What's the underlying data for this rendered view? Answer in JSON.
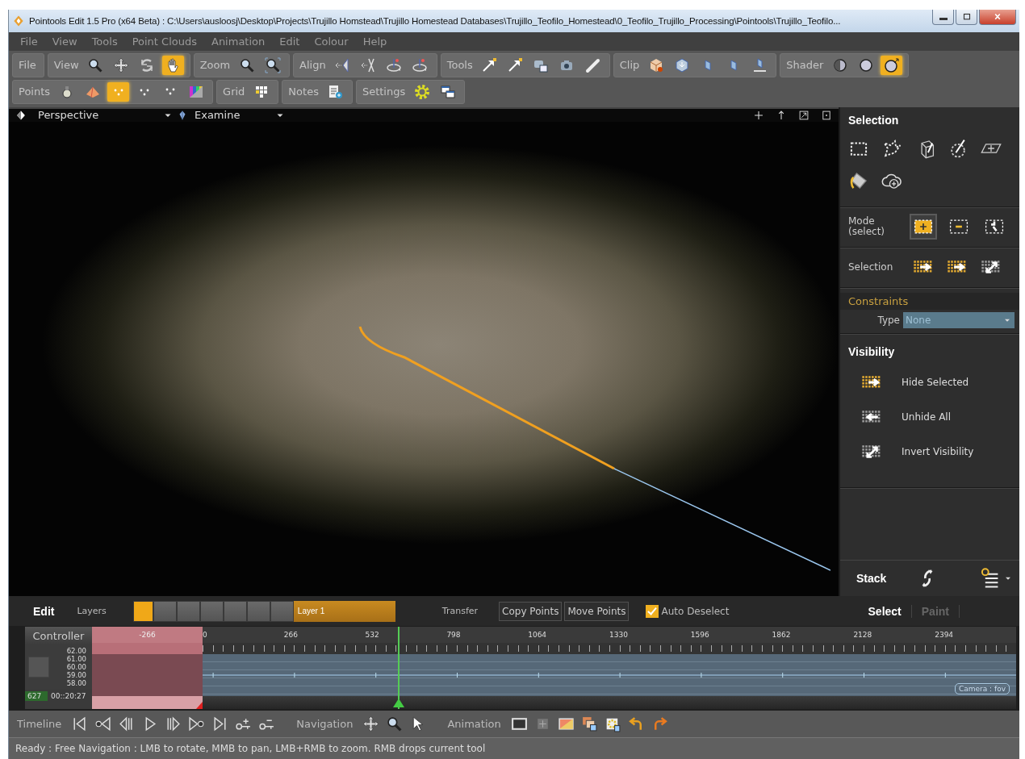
{
  "window": {
    "title": "Pointools Edit 1.5 Pro (x64 Beta)  :  C:\\Users\\ausloosj\\Desktop\\Projects\\Trujillo Homstead\\Trujillo Homestead Databases\\Trujillo_Teofilo_Homestead\\0_Teofilo_Trujillo_Processing\\Pointools\\Trujillo_Teofilo..."
  },
  "menu": [
    "File",
    "View",
    "Tools",
    "Point Clouds",
    "Animation",
    "Edit",
    "Colour",
    "Help"
  ],
  "toolbars": [
    {
      "groups": [
        {
          "label": "File"
        },
        {
          "label": "View",
          "tools": [
            {
              "kind": "magnifier",
              "selected": false
            },
            {
              "kind": "pan",
              "selected": false
            },
            {
              "kind": "orbit",
              "selected": false
            },
            {
              "kind": "hand",
              "selected": true
            }
          ]
        },
        {
          "label": "Zoom",
          "tools": [
            {
              "kind": "zoomframe",
              "selected": false
            },
            {
              "kind": "zoomcorners",
              "selected": false
            }
          ]
        },
        {
          "label": "Align",
          "tools": [
            {
              "kind": "aligntri",
              "selected": false
            },
            {
              "kind": "alignline",
              "selected": false
            },
            {
              "kind": "rotate",
              "selected": false
            },
            {
              "kind": "rotate",
              "selected": false
            }
          ]
        },
        {
          "label": "Tools",
          "tools": [
            {
              "kind": "arrowtool",
              "selected": false
            },
            {
              "kind": "arrowtool",
              "selected": false
            },
            {
              "kind": "camstack",
              "selected": false
            },
            {
              "kind": "camera",
              "selected": false
            },
            {
              "kind": "pencil",
              "selected": false
            }
          ]
        },
        {
          "label": "Clip",
          "tools": [
            {
              "kind": "cube",
              "selected": false
            },
            {
              "kind": "cubeout",
              "selected": false
            },
            {
              "kind": "plane",
              "selected": false
            },
            {
              "kind": "plane",
              "selected": false
            },
            {
              "kind": "planebase",
              "selected": false
            }
          ]
        },
        {
          "label": "Shader",
          "tools": [
            {
              "kind": "sphere",
              "selected": false
            },
            {
              "kind": "spherefull",
              "selected": false
            },
            {
              "kind": "spherearrow",
              "selected": true
            }
          ]
        }
      ]
    },
    {
      "groups": [
        {
          "label": "Points",
          "tools": [
            {
              "kind": "bulb",
              "selected": false
            },
            {
              "kind": "pyramid",
              "selected": false
            },
            {
              "kind": "dots",
              "selected": true
            },
            {
              "kind": "dots",
              "selected": false
            },
            {
              "kind": "dotsb",
              "selected": false
            },
            {
              "kind": "gradient",
              "selected": false
            }
          ]
        },
        {
          "label": "Grid",
          "tools": [
            {
              "kind": "grid",
              "selected": false
            }
          ]
        },
        {
          "label": "Notes",
          "tools": [
            {
              "kind": "note",
              "selected": false
            }
          ]
        },
        {
          "label": "Settings",
          "tools": [
            {
              "kind": "gear",
              "selected": false
            },
            {
              "kind": "windows",
              "selected": false
            }
          ]
        }
      ]
    }
  ],
  "viewport": {
    "projection": "Perspective",
    "mode": "Examine"
  },
  "side_panel": {
    "selection_title": "Selection",
    "selection_tools": [
      {
        "kind": "rectsel"
      },
      {
        "kind": "lasso"
      },
      {
        "kind": "box3d"
      },
      {
        "kind": "sphere3d"
      },
      {
        "kind": "planesel"
      },
      {
        "kind": "bucket"
      },
      {
        "kind": "cloudplus"
      }
    ],
    "mode_label": "Mode (select)",
    "modes": [
      {
        "kind": "add",
        "selected": true
      },
      {
        "kind": "subtract",
        "selected": false
      },
      {
        "kind": "undo",
        "selected": false
      }
    ],
    "selection_label": "Selection",
    "selection_ops": [
      {
        "kind": "gridright"
      },
      {
        "kind": "gridright"
      },
      {
        "kind": "griddiag"
      }
    ],
    "constraints_title": "Constraints",
    "type_label": "Type",
    "type_value": "None",
    "visibility_title": "Visibility",
    "visibility_actions": [
      {
        "kind": "gridright",
        "label": "Hide Selected"
      },
      {
        "kind": "gridleft",
        "label": "Unhide All"
      },
      {
        "kind": "griddiag",
        "label": "Invert Visibility"
      }
    ],
    "stack_title": "Stack"
  },
  "edit_bar": {
    "title": "Edit",
    "layers_label": "Layers",
    "layer_slots": [
      {
        "selected": true
      },
      {
        "selected": false
      },
      {
        "selected": false
      },
      {
        "selected": false
      },
      {
        "selected": false
      },
      {
        "selected": false
      },
      {
        "selected": false
      }
    ],
    "layer_name": "Layer 1",
    "transfer_label": "Transfer",
    "buttons": [
      "Copy Points",
      "Move Points"
    ],
    "auto_deselect": {
      "label": "Auto Deselect",
      "checked": true
    },
    "tabs": [
      {
        "label": "Select",
        "selected": true
      },
      {
        "label": "Paint",
        "selected": false
      }
    ]
  },
  "timeline": {
    "controller_label": "Controller",
    "ruler": [
      "-266",
      "0",
      "266",
      "532",
      "798",
      "1064",
      "1330",
      "1596",
      "1862",
      "2128",
      "2394"
    ],
    "values": [
      "62.00",
      "61.00",
      "60.00",
      "59.00",
      "58.00"
    ],
    "frame": "627",
    "time": "00::20:27",
    "track_label": "Camera : fov",
    "playhead": {
      "level": 0.332
    }
  },
  "transport": [
    {
      "label": "Timeline",
      "tools": [
        {
          "kind": "skipstart"
        },
        {
          "kind": "prevkey"
        },
        {
          "kind": "stepback"
        },
        {
          "kind": "play"
        },
        {
          "kind": "stepfwd"
        },
        {
          "kind": "nextkey"
        },
        {
          "kind": "skipend"
        },
        {
          "kind": "addkey"
        },
        {
          "kind": "removekey"
        }
      ]
    },
    {
      "label": "Navigation",
      "tools": [
        {
          "kind": "pan"
        },
        {
          "kind": "magnifier"
        },
        {
          "kind": "pointer"
        }
      ]
    },
    {
      "label": "Animation",
      "tools": [
        {
          "kind": "frame"
        },
        {
          "kind": "crosshair"
        },
        {
          "kind": "gradframe"
        },
        {
          "kind": "windowstack"
        },
        {
          "kind": "gearframe"
        },
        {
          "kind": "undo"
        },
        {
          "kind": "redo"
        }
      ]
    }
  ],
  "status_bar": "Ready : Free Navigation : LMB to rotate, MMB to pan, LMB+RMB to zoom. RMB drops current tool"
}
